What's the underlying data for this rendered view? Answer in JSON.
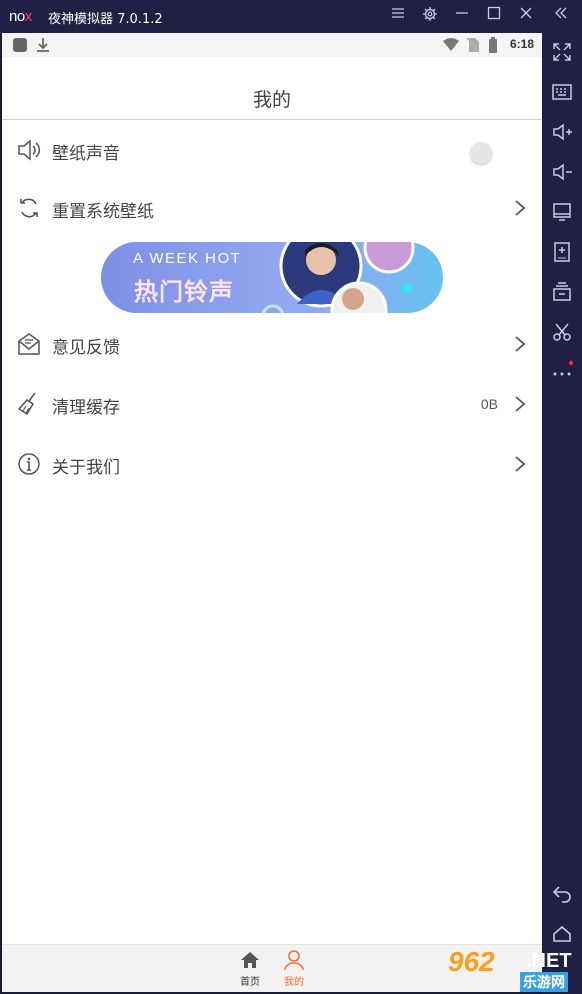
{
  "window": {
    "brand": [
      "no",
      "x"
    ],
    "title": "夜神模拟器 7.0.1.2",
    "controls": [
      "menu-icon",
      "settings-icon",
      "minimize-icon",
      "maximize-icon",
      "close-icon",
      "collapse-icon"
    ]
  },
  "sidebar": {
    "buttons": [
      "fullscreen-icon",
      "keyboard-icon",
      "volume-up-icon",
      "volume-down-icon",
      "screen-icon",
      "add-apk-icon",
      "multi-instance-icon",
      "scissors-icon",
      "more-icon",
      "back-icon",
      "home-icon"
    ],
    "notification_dot_color": "#ff2b2b"
  },
  "statusbar": {
    "time": "6:18",
    "icons": [
      "app-notification-icon",
      "download-icon",
      "wifi-icon",
      "no-sim-icon",
      "battery-icon"
    ]
  },
  "page": {
    "title": "我的"
  },
  "menu": [
    {
      "label": "壁纸声音",
      "icon": "speaker-icon",
      "control": "toggle"
    },
    {
      "label": "重置系统壁纸",
      "icon": "refresh-icon",
      "control": "chevron"
    },
    {
      "label": "意见反馈",
      "icon": "feedback-icon",
      "control": "chevron"
    },
    {
      "label": "清理缓存",
      "icon": "broom-icon",
      "control": "chevron",
      "value": "0B"
    },
    {
      "label": "关于我们",
      "icon": "info-icon",
      "control": "chevron"
    }
  ],
  "banner": {
    "subtitle": "A WEEK HOT",
    "title": "热门铃声"
  },
  "bottomnav": {
    "tabs": [
      {
        "label": "首页",
        "icon": "home-icon",
        "active": false
      },
      {
        "label": "我的",
        "icon": "profile-icon",
        "active": true
      }
    ],
    "active_color": "#ff6a2a"
  },
  "watermark": {
    "number": "962",
    "suffix": ".NET",
    "site": "乐游网"
  }
}
